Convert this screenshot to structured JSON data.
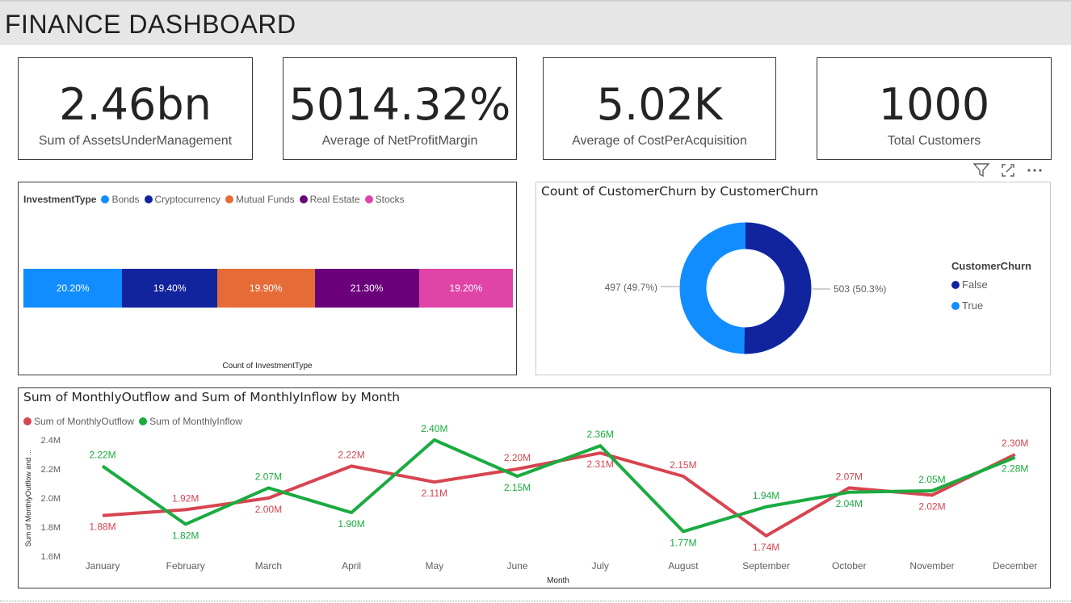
{
  "header": {
    "title": "FINANCE DASHBOARD"
  },
  "kpis": [
    {
      "value": "2.46bn",
      "label": "Sum of AssetsUnderManagement"
    },
    {
      "value": "5014.32%",
      "label": "Average of NetProfitMargin"
    },
    {
      "value": "5.02K",
      "label": "Average of CostPerAcquisition"
    },
    {
      "value": "1000",
      "label": "Total Customers"
    }
  ],
  "visual_toolbar": {
    "icons": [
      "filter-icon",
      "focus-mode-icon",
      "more-options-icon"
    ]
  },
  "investment_chart": {
    "legend_title": "InvestmentType",
    "axis_label": "Count of InvestmentType",
    "segments": [
      {
        "name": "Bonds",
        "label": "20.20%",
        "color": "#118dff"
      },
      {
        "name": "Cryptocurrency",
        "label": "19.40%",
        "color": "#12239e"
      },
      {
        "name": "Mutual Funds",
        "label": "19.90%",
        "color": "#e66c37"
      },
      {
        "name": "Real Estate",
        "label": "21.30%",
        "color": "#6b007b"
      },
      {
        "name": "Stocks",
        "label": "19.20%",
        "color": "#e044a7"
      }
    ]
  },
  "churn_chart": {
    "title": "Count of CustomerChurn by CustomerChurn",
    "legend_title": "CustomerChurn",
    "legend": [
      {
        "name": "False",
        "color": "#12239e"
      },
      {
        "name": "True",
        "color": "#118dff"
      }
    ],
    "left_label": "497 (49.7%)",
    "right_label": "503 (50.3%)"
  },
  "chart_data": [
    {
      "type": "bar",
      "title": "",
      "xlabel": "Count of InvestmentType",
      "categories": [
        "Bonds",
        "Cryptocurrency",
        "Mutual Funds",
        "Real Estate",
        "Stocks"
      ],
      "values": [
        20.2,
        19.4,
        19.9,
        21.3,
        19.2
      ],
      "unit": "%",
      "stacked": true,
      "legend": "top-left"
    },
    {
      "type": "pie",
      "title": "Count of CustomerChurn by CustomerChurn",
      "categories": [
        "False",
        "True"
      ],
      "values": [
        503,
        497
      ],
      "donut": true,
      "legend": "right"
    },
    {
      "type": "line",
      "title": "Sum of MonthlyOutflow and Sum of MonthlyInflow by Month",
      "xlabel": "Month",
      "ylabel": "Sum of MonthlyOutflow and ...",
      "categories": [
        "January",
        "February",
        "March",
        "April",
        "May",
        "June",
        "July",
        "August",
        "September",
        "October",
        "November",
        "December"
      ],
      "yticks": [
        "1.6M",
        "1.8M",
        "2.0M",
        "2.2M",
        "2.4M"
      ],
      "ylim": [
        1.6,
        2.4
      ],
      "series": [
        {
          "name": "Sum of MonthlyOutflow",
          "color": "#d64550",
          "values": [
            1.88,
            1.92,
            2.0,
            2.22,
            2.11,
            2.2,
            2.31,
            2.15,
            1.74,
            2.07,
            2.02,
            2.3
          ],
          "labels": [
            "1.88M",
            "1.92M",
            "2.00M",
            "2.22M",
            "2.11M",
            "2.20M",
            "2.31M",
            "2.15M",
            "1.74M",
            "2.07M",
            "2.02M",
            "2.30M"
          ]
        },
        {
          "name": "Sum of MonthlyInflow",
          "color": "#1aab40",
          "values": [
            2.22,
            1.82,
            2.07,
            1.9,
            2.4,
            2.15,
            2.36,
            1.77,
            1.94,
            2.04,
            2.05,
            2.28
          ],
          "labels": [
            "2.22M",
            "1.82M",
            "2.07M",
            "1.90M",
            "2.40M",
            "2.15M",
            "2.36M",
            "1.77M",
            "1.94M",
            "2.04M",
            "2.05M",
            "2.28M"
          ]
        }
      ],
      "legend": "top-left"
    }
  ]
}
